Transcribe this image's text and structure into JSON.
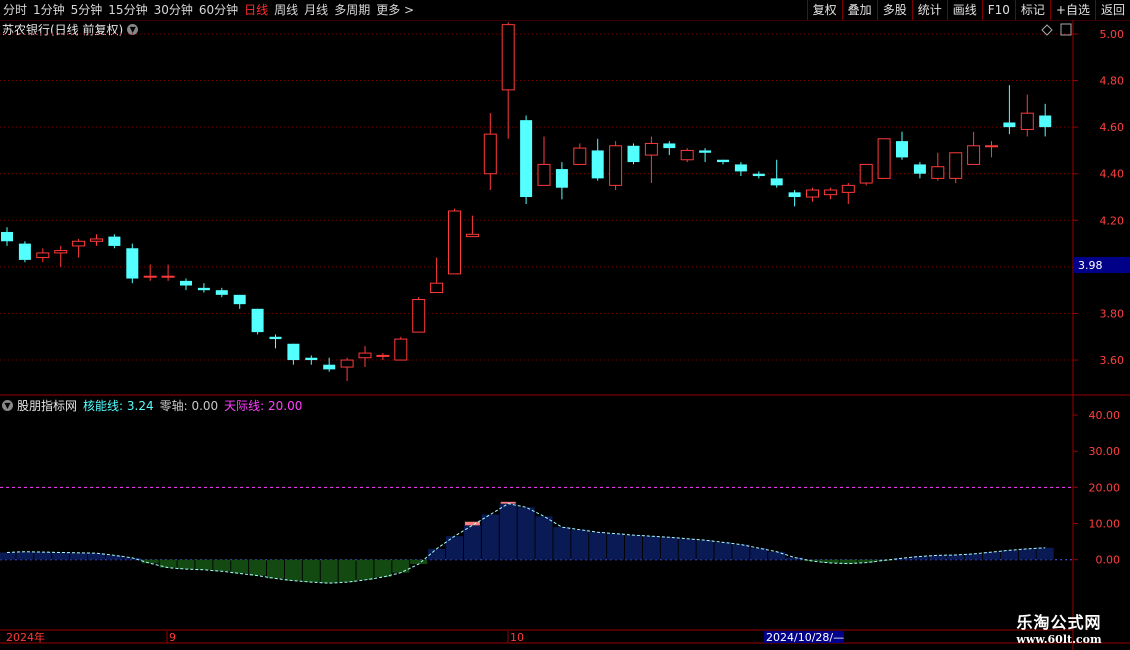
{
  "toolbar": {
    "periods": [
      "分时",
      "1分钟",
      "5分钟",
      "15分钟",
      "30分钟",
      "60分钟",
      "日线",
      "周线",
      "月线",
      "多周期",
      "更多 >"
    ],
    "active_index": 6,
    "right_buttons": [
      "复权",
      "叠加",
      "多股",
      "统计",
      "画线",
      "F10",
      "标记",
      "+自选",
      "返回"
    ]
  },
  "main_title": "苏农银行(日线 前复权)",
  "current_price": "3.98",
  "indicator": {
    "name": "股朋指标网",
    "core_label": "核能线: 3.24",
    "zero_label": "零轴: 0.00",
    "sky_label": "天际线: 20.00"
  },
  "date_axis": {
    "labels": [
      "2024年",
      "9",
      "10"
    ],
    "cursor_date": "2024/10/28/—"
  },
  "watermark": {
    "title": "乐淘公式网",
    "url": "www.60lt.com"
  },
  "colors": {
    "up": "#ff3a3a",
    "down": "#54ffff",
    "grid": "#7a0000",
    "sky": "#ff40ff",
    "zero": "#5a5aff"
  },
  "chart_data": [
    {
      "type": "candlestick",
      "yticks": [
        3.6,
        3.8,
        4.0,
        4.2,
        4.4,
        4.6,
        4.8,
        5.0
      ],
      "tick_labels": [
        "3.60",
        "3.80",
        "4.00",
        "4.20",
        "4.40",
        "4.60",
        "4.80",
        "5.00"
      ],
      "ylim": [
        3.45,
        5.06
      ],
      "candles": [
        [
          4.15,
          4.11,
          4.17,
          4.09
        ],
        [
          4.1,
          4.03,
          4.11,
          4.02
        ],
        [
          4.04,
          4.06,
          4.08,
          4.02
        ],
        [
          4.06,
          4.07,
          4.09,
          4.0
        ],
        [
          4.09,
          4.11,
          4.12,
          4.04
        ],
        [
          4.11,
          4.12,
          4.14,
          4.09
        ],
        [
          4.13,
          4.09,
          4.14,
          4.08
        ],
        [
          4.08,
          3.95,
          4.1,
          3.93
        ],
        [
          3.96,
          3.96,
          4.01,
          3.94
        ],
        [
          3.96,
          3.96,
          4.01,
          3.94
        ],
        [
          3.94,
          3.92,
          3.95,
          3.9
        ],
        [
          3.91,
          3.9,
          3.93,
          3.89
        ],
        [
          3.9,
          3.88,
          3.91,
          3.87
        ],
        [
          3.88,
          3.84,
          3.88,
          3.82
        ],
        [
          3.82,
          3.72,
          3.82,
          3.71
        ],
        [
          3.7,
          3.69,
          3.71,
          3.65
        ],
        [
          3.67,
          3.6,
          3.67,
          3.58
        ],
        [
          3.61,
          3.6,
          3.62,
          3.58
        ],
        [
          3.58,
          3.56,
          3.61,
          3.55
        ],
        [
          3.57,
          3.6,
          3.61,
          3.51
        ],
        [
          3.61,
          3.63,
          3.66,
          3.57
        ],
        [
          3.62,
          3.62,
          3.63,
          3.6
        ],
        [
          3.6,
          3.69,
          3.7,
          3.6
        ],
        [
          3.72,
          3.86,
          3.87,
          3.72
        ],
        [
          3.89,
          3.93,
          4.04,
          3.9
        ],
        [
          3.97,
          4.24,
          4.25,
          3.97
        ],
        [
          4.13,
          4.14,
          4.22,
          4.13
        ],
        [
          4.4,
          4.57,
          4.66,
          4.33
        ],
        [
          4.76,
          5.04,
          5.05,
          4.55
        ],
        [
          4.63,
          4.3,
          4.65,
          4.27
        ],
        [
          4.35,
          4.44,
          4.56,
          4.35
        ],
        [
          4.42,
          4.34,
          4.45,
          4.29
        ],
        [
          4.44,
          4.51,
          4.53,
          4.44
        ],
        [
          4.5,
          4.38,
          4.55,
          4.37
        ],
        [
          4.35,
          4.52,
          4.54,
          4.33
        ],
        [
          4.52,
          4.45,
          4.53,
          4.44
        ],
        [
          4.48,
          4.53,
          4.56,
          4.36
        ],
        [
          4.53,
          4.51,
          4.54,
          4.48
        ],
        [
          4.46,
          4.5,
          4.51,
          4.45
        ],
        [
          4.5,
          4.49,
          4.51,
          4.45
        ],
        [
          4.46,
          4.45,
          4.46,
          4.44
        ],
        [
          4.44,
          4.41,
          4.45,
          4.39
        ],
        [
          4.4,
          4.39,
          4.41,
          4.38
        ],
        [
          4.38,
          4.35,
          4.46,
          4.34
        ],
        [
          4.32,
          4.3,
          4.33,
          4.26
        ],
        [
          4.3,
          4.33,
          4.34,
          4.28
        ],
        [
          4.31,
          4.33,
          4.34,
          4.29
        ],
        [
          4.32,
          4.35,
          4.36,
          4.27
        ],
        [
          4.36,
          4.44,
          4.44,
          4.35
        ],
        [
          4.38,
          4.55,
          4.55,
          4.38
        ],
        [
          4.54,
          4.47,
          4.58,
          4.46
        ],
        [
          4.44,
          4.4,
          4.45,
          4.38
        ],
        [
          4.38,
          4.43,
          4.49,
          4.37
        ],
        [
          4.38,
          4.49,
          4.49,
          4.36
        ],
        [
          4.44,
          4.52,
          4.58,
          4.44
        ],
        [
          4.52,
          4.52,
          4.54,
          4.47
        ],
        [
          4.62,
          4.6,
          4.78,
          4.57
        ],
        [
          4.59,
          4.66,
          4.74,
          4.56
        ],
        [
          4.65,
          4.6,
          4.7,
          4.56
        ]
      ]
    },
    {
      "type": "bar",
      "yticks": [
        0,
        10,
        20,
        30,
        40
      ],
      "tick_labels": [
        "0.00",
        "10.00",
        "20.00",
        "30.00",
        "40.00"
      ],
      "ylim": [
        -7,
        45
      ],
      "sky_line": 20,
      "zero_line": 0,
      "values": [
        2,
        2.2,
        2.1,
        2.0,
        1.9,
        1.8,
        1.2,
        0.5,
        -1,
        -2.2,
        -2.6,
        -2.8,
        -3.2,
        -3.8,
        -4.4,
        -5.2,
        -5.8,
        -6.2,
        -6.5,
        -6.2,
        -5.6,
        -4.8,
        -3.6,
        -1.2,
        3,
        6.5,
        9.5,
        12.5,
        15.5,
        14.5,
        12,
        9,
        8.3,
        7.6,
        7.2,
        6.8,
        6.5,
        6.2,
        5.8,
        5.4,
        4.8,
        4.2,
        3.2,
        2.2,
        0.6,
        -0.4,
        -0.9,
        -1.1,
        -0.8,
        -0.2,
        0.4,
        0.9,
        1.2,
        1.3,
        1.6,
        2.1,
        2.6,
        3,
        3.3
      ],
      "highlight": [
        null,
        null,
        null,
        null,
        null,
        null,
        null,
        null,
        null,
        null,
        null,
        null,
        null,
        null,
        null,
        null,
        null,
        null,
        null,
        null,
        null,
        null,
        null,
        null,
        null,
        null,
        10.5,
        12.5,
        16,
        14.5,
        12,
        null,
        null,
        null,
        null,
        null,
        null,
        null,
        null,
        null,
        null,
        null,
        null,
        null,
        null,
        null,
        null,
        null,
        null,
        null,
        null,
        null,
        null,
        null,
        null,
        null,
        null,
        null,
        null
      ]
    }
  ]
}
